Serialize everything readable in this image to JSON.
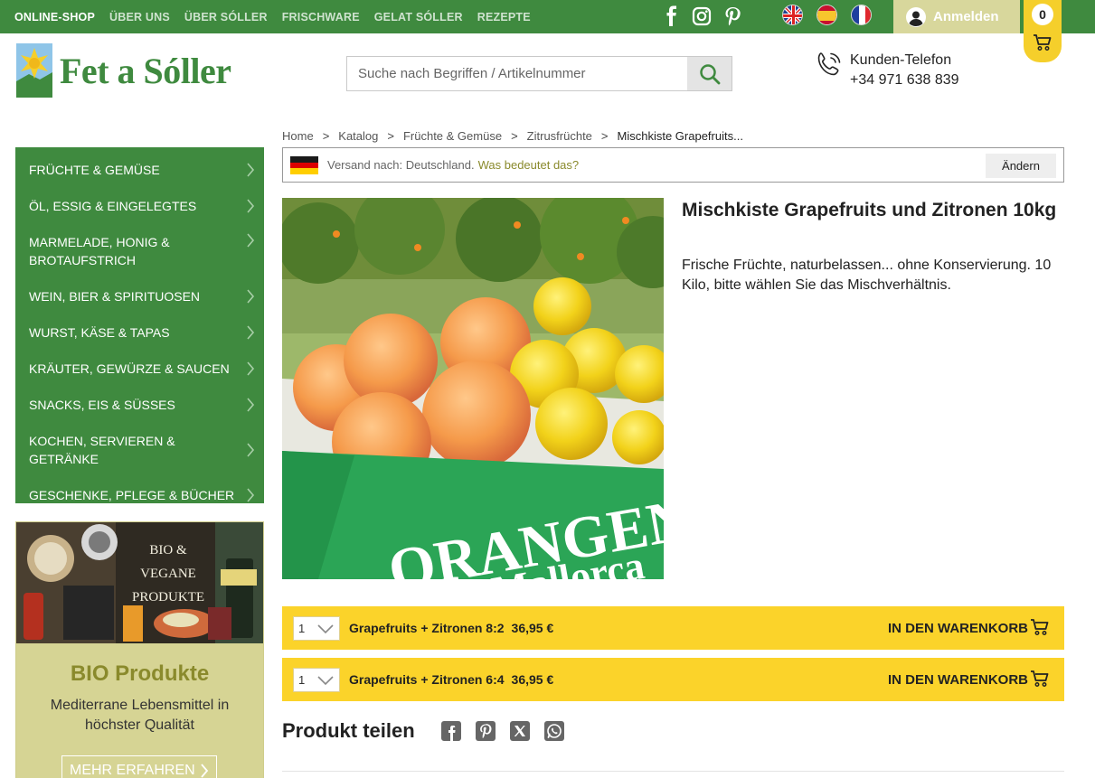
{
  "topnav": {
    "items": [
      "ONLINE-SHOP",
      "ÜBER UNS",
      "ÜBER SÓLLER",
      "FRISCHWARE",
      "GELAT SÓLLER",
      "REZEPTE"
    ]
  },
  "social": {
    "icons": [
      "facebook-icon",
      "instagram-icon",
      "pinterest-icon"
    ]
  },
  "languages": {
    "flags": [
      "flag-uk-icon",
      "flag-spain-icon",
      "flag-france-icon"
    ]
  },
  "login": {
    "label": "Anmelden"
  },
  "cart": {
    "count": "0"
  },
  "logo": {
    "text": "Fet a Sóller"
  },
  "search": {
    "placeholder": "Suche nach Begriffen / Artikelnummer"
  },
  "phone": {
    "title": "Kunden-Telefon",
    "number": "+34 971 638 839"
  },
  "sidebar": {
    "items": [
      "FRÜCHTE & GEMÜSE",
      "ÖL, ESSIG & EINGELEGTES",
      "MARMELADE, HONIG & BROTAUFSTRICH",
      "WEIN, BIER & SPIRITUOSEN",
      "WURST, KÄSE & TAPAS",
      "KRÄUTER, GEWÜRZE & SAUCEN",
      "SNACKS, EIS & SÜSSES",
      "KOCHEN, SERVIEREN & GETRÄNKE",
      "GESCHENKE, PFLEGE & BÜCHER"
    ]
  },
  "promo": {
    "image_text": "BIO & VEGANE PRODUKTE",
    "title": "BIO Produkte",
    "text": "Mediterrane Lebensmittel in höchster Qualität",
    "button": "MEHR ERFAHREN"
  },
  "breadcrumb": {
    "items": [
      "Home",
      "Katalog",
      "Früchte & Gemüse",
      "Zitrusfrüchte",
      "Mischkiste Grapefruits..."
    ]
  },
  "shipping": {
    "text": "Versand nach: Deutschland.",
    "link": "Was bedeutet das?",
    "button": "Ändern"
  },
  "product": {
    "image_text": "ORANGEN de Mallorca",
    "title": "Mischkiste Grapefruits und Zitronen 10kg",
    "description": "Frische Früchte, naturbelassen... ohne Konservierung. 10 Kilo, bitte wählen Sie das Mischverhältnis.",
    "variants": [
      {
        "qty": "1",
        "name": "Grapefruits + Zitronen 8:2",
        "price": "36,95 €",
        "button": "IN DEN WARENKORB"
      },
      {
        "qty": "1",
        "name": "Grapefruits + Zitronen 6:4",
        "price": "36,95 €",
        "button": "IN DEN WARENKORB"
      }
    ]
  },
  "share": {
    "label": "Produkt teilen",
    "icons": [
      "facebook-icon",
      "pinterest-icon",
      "x-twitter-icon",
      "whatsapp-icon"
    ]
  },
  "colors": {
    "brand_green": "#3f8a3f",
    "accent_yellow": "#fbd32a",
    "olive": "#8a8a2c",
    "khaki": "#d6d494"
  }
}
